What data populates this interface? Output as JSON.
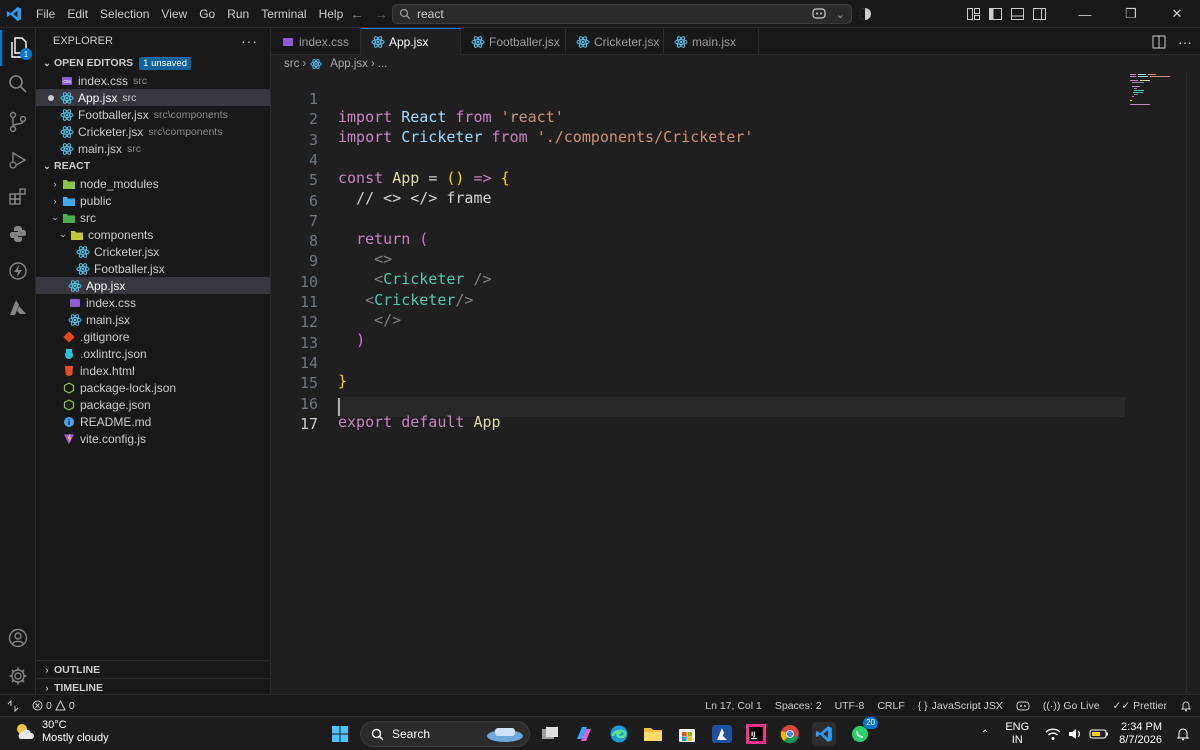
{
  "titlebar": {
    "menu": [
      "File",
      "Edit",
      "Selection",
      "View",
      "Go",
      "Run",
      "Terminal",
      "Help"
    ],
    "command_center": "react"
  },
  "activity": {
    "explorer_badge": "1"
  },
  "explorer": {
    "header": "EXPLORER",
    "open_editors": {
      "title": "OPEN EDITORS",
      "badge": "1 unsaved",
      "items": [
        {
          "name": "index.css",
          "desc": "src"
        },
        {
          "name": "App.jsx",
          "desc": "src"
        },
        {
          "name": "Footballer.jsx",
          "desc": "src\\components"
        },
        {
          "name": "Cricketer.jsx",
          "desc": "src\\components"
        },
        {
          "name": "main.jsx",
          "desc": "src"
        }
      ]
    },
    "project": {
      "title": "REACT",
      "items": [
        {
          "name": "node_modules"
        },
        {
          "name": "public"
        },
        {
          "name": "src"
        },
        {
          "name": "components"
        },
        {
          "name": "Cricketer.jsx"
        },
        {
          "name": "Footballer.jsx"
        },
        {
          "name": "App.jsx"
        },
        {
          "name": "index.css"
        },
        {
          "name": "main.jsx"
        },
        {
          "name": ".gitignore"
        },
        {
          "name": ".oxlintrc.json"
        },
        {
          "name": "index.html"
        },
        {
          "name": "package-lock.json"
        },
        {
          "name": "package.json"
        },
        {
          "name": "README.md"
        },
        {
          "name": "vite.config.js"
        }
      ]
    },
    "outline": "OUTLINE",
    "timeline": "TIMELINE"
  },
  "tabs": [
    {
      "label": "index.css"
    },
    {
      "label": "App.jsx"
    },
    {
      "label": "Footballer.jsx"
    },
    {
      "label": "Cricketer.jsx"
    },
    {
      "label": "main.jsx"
    }
  ],
  "breadcrumb": {
    "folder": "src",
    "file": "App.jsx",
    "more": "..."
  },
  "editor": {
    "line_numbers": [
      "1",
      "2",
      "3",
      "4",
      "5",
      "6",
      "7",
      "8",
      "9",
      "10",
      "11",
      "12",
      "13",
      "14",
      "15",
      "16",
      "17"
    ],
    "current_line": "17"
  },
  "statusbar": {
    "errors": "0",
    "warnings": "0",
    "position": "Ln 17, Col 1",
    "spaces": "Spaces: 2",
    "encoding": "UTF-8",
    "eol": "CRLF",
    "language": "JavaScript JSX",
    "golive": "Go Live",
    "prettier": "Prettier"
  },
  "taskbar": {
    "temp": "30°C",
    "weather": "Mostly cloudy",
    "search": "Search",
    "whatsapp_badge": "20",
    "lang1": "ENG",
    "lang2": "IN",
    "time": "2:34 PM",
    "date": "8/7/2026"
  },
  "colors": {
    "accent": "#0078d4",
    "keyword": "#c586c0",
    "string": "#ce9178",
    "component": "#4ec9b0",
    "function": "#dcdcaa"
  }
}
